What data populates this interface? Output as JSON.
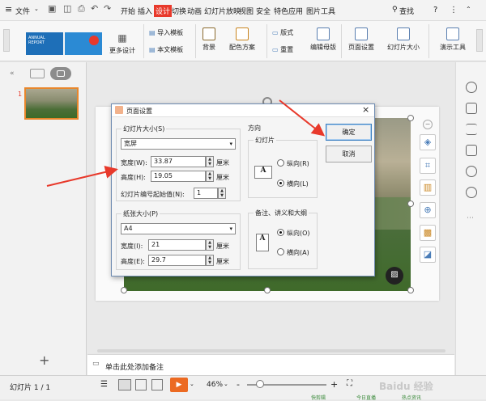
{
  "menubar": {
    "file": "文件",
    "tabs": [
      "开始",
      "插入",
      "设计",
      "切换",
      "动画",
      "幻灯片放映",
      "视图",
      "安全",
      "特色应用",
      "图片工具"
    ],
    "active_tab": "设计",
    "search": "查找",
    "help": "?"
  },
  "ribbon": {
    "thumb1_text": "ANNUAL REPORT",
    "more_designs": "更多设计",
    "import_template": "导入模板",
    "text_template": "本文模板",
    "background": "背景",
    "color_scheme": "配色方案",
    "layout": "版式",
    "reset": "重置",
    "edit_master": "编辑母版",
    "page_setup": "页面设置",
    "slide_size": "幻灯片大小",
    "presentation_tools": "演示工具"
  },
  "leftpane": {
    "slide_number": "1",
    "add_slide": "+"
  },
  "notes": {
    "placeholder": "单击此处添加备注"
  },
  "statusbar": {
    "slide_info": "幻灯片 1 / 1",
    "zoom": "46%",
    "minus": "-",
    "plus": "+",
    "watermark": "Baidu 经验",
    "bottom_right_1": "快剪辑",
    "bottom_right_2": "今日直播",
    "bottom_right_3": "热点资讯"
  },
  "dialog": {
    "title": "页面设置",
    "slide_size_label": "幻灯片大小(S)",
    "slide_size_value": "宽屏",
    "width_label": "宽度(W):",
    "width_value": "33.87",
    "height_label": "高度(H):",
    "height_value": "19.05",
    "unit": "厘米",
    "numbering_label": "幻灯片编号起始值(N):",
    "numbering_value": "1",
    "paper_size_label": "纸张大小(P)",
    "paper_size_value": "A4",
    "paper_width_label": "宽度(I):",
    "paper_width_value": "21",
    "paper_height_label": "高度(E):",
    "paper_height_value": "29.7",
    "orientation_label": "方向",
    "slides_group_label": "幻灯片",
    "portrait": "纵向(R)",
    "landscape": "横向(L)",
    "notes_group_label": "备注、讲义和大纲",
    "notes_portrait": "纵向(O)",
    "notes_landscape": "横向(A)",
    "ok": "确定",
    "cancel": "取消",
    "close": "×",
    "orient_letter": "A"
  },
  "colors": {
    "accent": "#e8392b",
    "active_tab": "#e8392b",
    "play": "#ec6a22"
  }
}
